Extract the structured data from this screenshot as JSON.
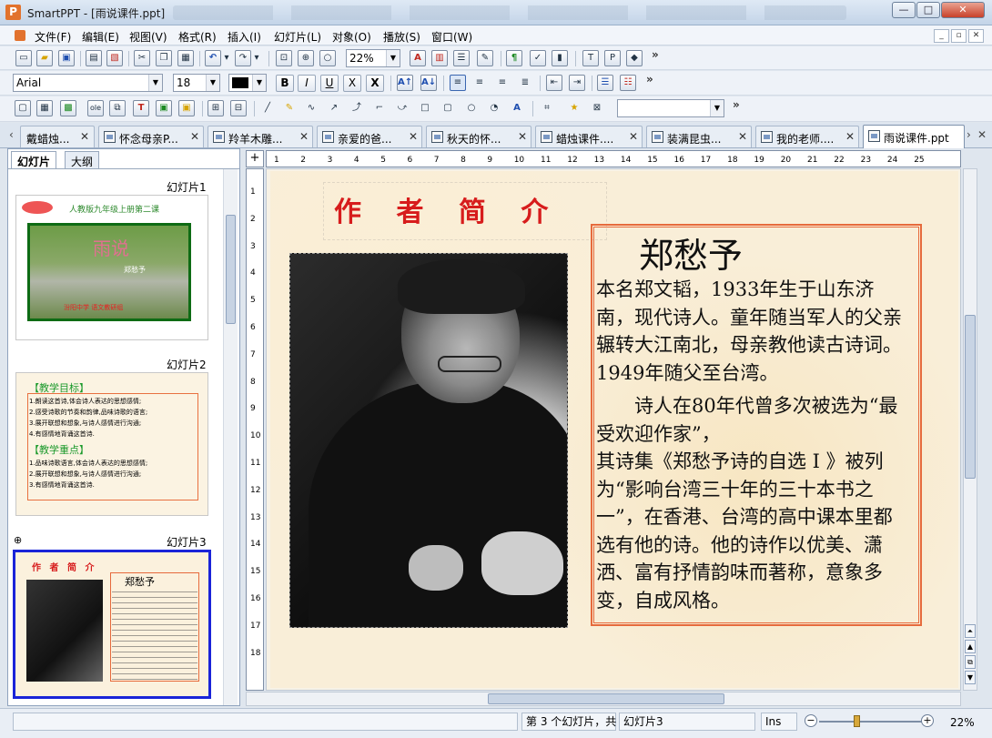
{
  "window": {
    "title": "SmartPPT - [雨说课件.ppt]",
    "logo_letter": "P",
    "minimize_glyph": "—",
    "maximize_glyph": "□",
    "close_glyph": "✕"
  },
  "menu": {
    "items": [
      "文件(F)",
      "编辑(E)",
      "视图(V)",
      "格式(R)",
      "插入(I)",
      "幻灯片(L)",
      "对象(O)",
      "播放(S)",
      "窗口(W)"
    ],
    "mdi": [
      "_",
      "▫",
      "✕"
    ]
  },
  "toolbar1": {
    "zoom": "22%",
    "more": "»"
  },
  "toolbar2": {
    "font": "Arial",
    "size": "18",
    "bold": "B",
    "italic": "I",
    "underline": "U",
    "strike": "X",
    "shadow": "X",
    "more": "»"
  },
  "toolbar3": {
    "more": "»"
  },
  "doc_tabs": [
    {
      "label": "戴蜡烛..."
    },
    {
      "label": "怀念母亲P..."
    },
    {
      "label": "羚羊木雕..."
    },
    {
      "label": "亲爱的爸..."
    },
    {
      "label": "秋天的怀..."
    },
    {
      "label": "蜡烛课件...."
    },
    {
      "label": "装满昆虫..."
    },
    {
      "label": "我的老师...."
    },
    {
      "label": "雨说课件.ppt"
    }
  ],
  "left_panel": {
    "tabs": [
      "幻灯片",
      "大纲"
    ],
    "slides": [
      {
        "label": "幻灯片1"
      },
      {
        "label": "幻灯片2"
      },
      {
        "label": "幻灯片3"
      }
    ],
    "thumb1": {
      "subtitle": "人教版九年级上册第二课",
      "title": "雨说",
      "author": "郑愁予",
      "footer": "汾阳中学 语文教研组"
    },
    "thumb2": {
      "heading1": "【教学目标】",
      "goals": [
        "1.朗读这首诗,体会诗人表达的思想感情;",
        "2.感受诗歌的节奏和韵律,品味诗歌的语言;",
        "3.展开联想和想象,与诗人感情进行沟通;",
        "4.有感情地背诵这首诗."
      ],
      "heading2": "【教学重点】",
      "keys": [
        "1.品味诗歌语言,体会诗人表达的思想感情;",
        "2.展开联想和想象,与诗人感情进行沟通;",
        "3.有感情地背诵这首诗."
      ]
    },
    "thumb3": {
      "title": "作 者 简 介",
      "name": "郑愁予"
    }
  },
  "ruler": {
    "corner": "+",
    "h_ticks": [
      "1",
      "2",
      "3",
      "4",
      "5",
      "6",
      "7",
      "8",
      "9",
      "10",
      "11",
      "12",
      "13",
      "14",
      "15",
      "16",
      "17",
      "18",
      "19",
      "20",
      "21",
      "22",
      "23",
      "24",
      "25"
    ],
    "v_ticks": [
      "1",
      "2",
      "3",
      "4",
      "5",
      "6",
      "7",
      "8",
      "9",
      "10",
      "11",
      "12",
      "13",
      "14",
      "15",
      "16",
      "17",
      "18"
    ]
  },
  "slide": {
    "title": "作 者 简 介",
    "author_name": "郑愁予",
    "para1": "本名郑文韬，1933年生于山东济南，现代诗人。童年随当军人的父亲辗转大江南北，母亲教他读古诗词。1949年随父至台湾。",
    "para2": "诗人在80年代曾多次被选为“最受欢迎作家”，",
    "para3": "其诗集《郑愁予诗的自选 I 》被列为“影响台湾三十年的三十本书之一”，在香港、台湾的高中课本里都选有他的诗。他的诗作以优美、潇洒、富有抒情韵味而著称，意象多变，自成风格。"
  },
  "status": {
    "slide_info": "第 3 个幻灯片，共",
    "slide_name": "幻灯片3",
    "mode": "Ins",
    "zoom": "22%",
    "zoom_out": "−",
    "zoom_in": "+",
    "zoom_fraction": 0.22
  }
}
